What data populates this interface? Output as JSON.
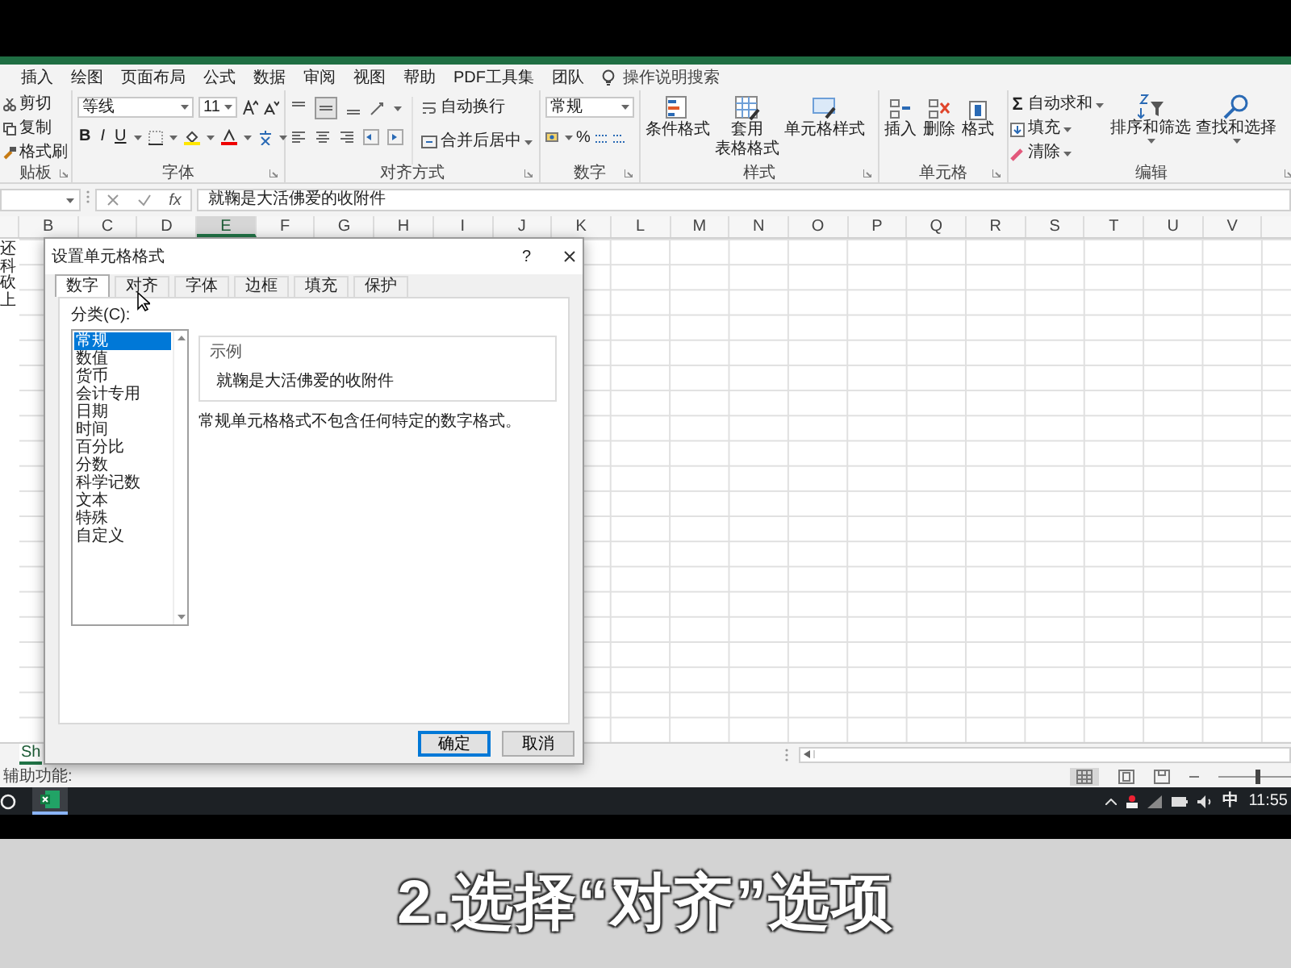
{
  "ribbon_tabs": [
    "插入",
    "绘图",
    "页面布局",
    "公式",
    "数据",
    "审阅",
    "视图",
    "帮助",
    "PDF工具集",
    "团队"
  ],
  "search_hint": "操作说明搜索",
  "clipboard": {
    "items": [
      "剪切",
      "复制",
      "格式刷"
    ],
    "label": "贴板"
  },
  "font": {
    "name": "等线",
    "size": "11",
    "styles": [
      "B",
      "I",
      "U"
    ],
    "label": "字体"
  },
  "alignment": {
    "wrap": "自动换行",
    "merge": "合并后居中",
    "label": "对齐方式"
  },
  "number": {
    "format": "常规",
    "percent": "%",
    "label": "数字"
  },
  "styles": {
    "buttons": [
      {
        "lines": [
          "条件格式"
        ]
      },
      {
        "lines": [
          "套用",
          "表格格式"
        ]
      },
      {
        "lines": [
          "单元格样式"
        ]
      }
    ],
    "label": "样式"
  },
  "cells": {
    "buttons": [
      "插入",
      "删除",
      "格式"
    ],
    "label": "单元格"
  },
  "editing": {
    "sum_glyph": "Σ",
    "items": [
      "自动求和",
      "填充",
      "清除"
    ],
    "buttons": [
      "排序和筛选",
      "查找和选择"
    ],
    "label": "编辑"
  },
  "formula_bar": {
    "function_label": "fx",
    "value": "就鞠是大活佛爱的收附件"
  },
  "columns": [
    {
      "label": "B",
      "selected": false
    },
    {
      "label": "C",
      "selected": false
    },
    {
      "label": "D",
      "selected": false
    },
    {
      "label": "E",
      "selected": true
    },
    {
      "label": "F",
      "selected": false
    },
    {
      "label": "G",
      "selected": false
    },
    {
      "label": "H",
      "selected": false
    },
    {
      "label": "I",
      "selected": false
    },
    {
      "label": "J",
      "selected": false
    },
    {
      "label": "K",
      "selected": false
    },
    {
      "label": "L",
      "selected": false
    },
    {
      "label": "M",
      "selected": false
    },
    {
      "label": "N",
      "selected": false
    },
    {
      "label": "O",
      "selected": false
    },
    {
      "label": "P",
      "selected": false
    },
    {
      "label": "Q",
      "selected": false
    },
    {
      "label": "R",
      "selected": false
    },
    {
      "label": "S",
      "selected": false
    },
    {
      "label": "T",
      "selected": false
    },
    {
      "label": "U",
      "selected": false
    },
    {
      "label": "V",
      "selected": false
    }
  ],
  "column_a_text": [
    "还",
    "科",
    "砍",
    "上"
  ],
  "dialog": {
    "title": "设置单元格格式",
    "help": "?",
    "tabs": [
      {
        "label": "数字",
        "selected": true
      },
      {
        "label": "对齐",
        "selected": false
      },
      {
        "label": "字体",
        "selected": false
      },
      {
        "label": "边框",
        "selected": false
      },
      {
        "label": "填充",
        "selected": false
      },
      {
        "label": "保护",
        "selected": false
      }
    ],
    "category_label": "分类(C):",
    "categories": [
      {
        "label": "常规",
        "selected": true
      },
      {
        "label": "数值",
        "selected": false
      },
      {
        "label": "货币",
        "selected": false
      },
      {
        "label": "会计专用",
        "selected": false
      },
      {
        "label": "日期",
        "selected": false
      },
      {
        "label": "时间",
        "selected": false
      },
      {
        "label": "百分比",
        "selected": false
      },
      {
        "label": "分数",
        "selected": false
      },
      {
        "label": "科学记数",
        "selected": false
      },
      {
        "label": "文本",
        "selected": false
      },
      {
        "label": "特殊",
        "selected": false
      },
      {
        "label": "自定义",
        "selected": false
      }
    ],
    "sample_label": "示例",
    "sample_value": "就鞠是大活佛爱的收附件",
    "description": "常规单元格格式不包含任何特定的数字格式。",
    "buttons": [
      "确定",
      "取消"
    ]
  },
  "sheet_tab": "Sh",
  "status_text": "辅助功能:",
  "zoom_slider": {
    "level": 0.5
  },
  "taskbar": {
    "ime": "中",
    "clock": "11:55"
  },
  "caption": "2.选择“对齐”选项"
}
